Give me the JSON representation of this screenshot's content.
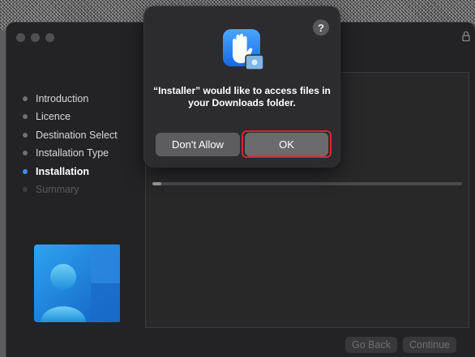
{
  "sidebar": {
    "steps": [
      {
        "label": "Introduction",
        "state": "done"
      },
      {
        "label": "Licence",
        "state": "done"
      },
      {
        "label": "Destination Select",
        "state": "done"
      },
      {
        "label": "Installation Type",
        "state": "done"
      },
      {
        "label": "Installation",
        "state": "current"
      },
      {
        "label": "Summary",
        "state": "pending"
      }
    ]
  },
  "progress": {
    "fraction": 0.03
  },
  "footer": {
    "go_back_label": "Go Back",
    "continue_label": "Continue"
  },
  "dialog": {
    "help_label": "?",
    "message": "“Installer” would like to access files in your Downloads folder.",
    "dont_allow_label": "Don't Allow",
    "ok_label": "OK",
    "icon": "raised-hand-privacy-icon"
  },
  "colors": {
    "accent": "#3d8ff6",
    "highlight": "#d8262c",
    "icon_blue": "#2f86f3"
  }
}
